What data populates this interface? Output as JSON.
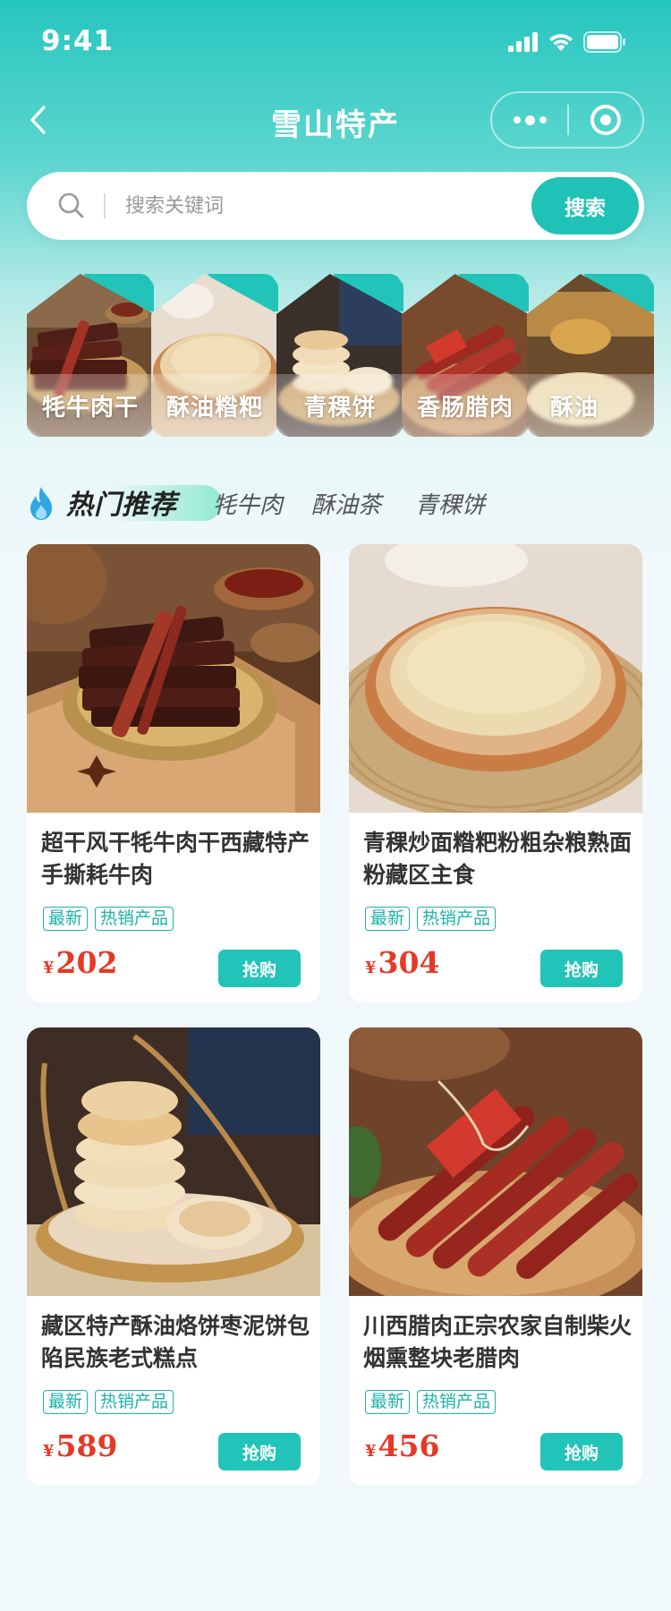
{
  "status_bar": {
    "time": "9:41"
  },
  "nav": {
    "title": "雪山特产"
  },
  "search": {
    "placeholder": "搜索关键词",
    "button": "搜索"
  },
  "categories": [
    {
      "label": "牦牛肉干"
    },
    {
      "label": "酥油糌粑"
    },
    {
      "label": "青稞饼"
    },
    {
      "label": "香肠腊肉"
    },
    {
      "label": "酥油"
    }
  ],
  "tabs": {
    "hot": "热门推荐",
    "items": [
      "牦牛肉",
      "酥油茶",
      "青稞饼"
    ]
  },
  "products": [
    {
      "title": "超干风干牦牛肉干西藏特产手撕耗牛肉",
      "tags": [
        "最新",
        "热销产品"
      ],
      "currency": "¥",
      "price": "202",
      "button": "抢购"
    },
    {
      "title": "青稞炒面糌粑粉粗杂粮熟面粉藏区主食",
      "tags": [
        "最新",
        "热销产品"
      ],
      "currency": "¥",
      "price": "304",
      "button": "抢购"
    },
    {
      "title": "藏区特产酥油烙饼枣泥饼包陷民族老式糕点",
      "tags": [
        "最新",
        "热销产品"
      ],
      "currency": "¥",
      "price": "589",
      "button": "抢购"
    },
    {
      "title": "川西腊肉正宗农家自制柴火烟熏整块老腊肉",
      "tags": [
        "最新",
        "热销产品"
      ],
      "currency": "¥",
      "price": "456",
      "button": "抢购"
    }
  ],
  "colors": {
    "accent": "#22c3b8",
    "price": "#e53926",
    "header": "#26c6bf"
  }
}
